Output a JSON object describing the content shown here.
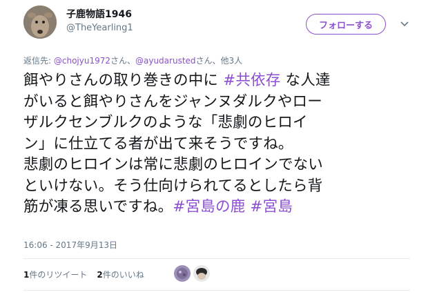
{
  "user": {
    "display_name": "子鹿物語1946",
    "handle": "@TheYearling1"
  },
  "follow_label": "フォローする",
  "reply": {
    "prefix": "返信先: ",
    "mention1": "@chojyu1972",
    "sep1": "さん、",
    "mention2": "@ayudarusted",
    "suffix": "さん、他3人"
  },
  "tweet": {
    "l1a": "餌やりさんの取り巻きの中に ",
    "tag1": "#共依存",
    "l1b": " な人達",
    "l2": "がいると餌やりさんをジャンヌダルクやロー",
    "l3": "ザルクセンブルクのような「悲劇のヒロイ",
    "l4": "ン」に仕立てる者が出て来そうですね。",
    "l5": "悲劇のヒロインは常に悲劇のヒロインでない",
    "l6": "といけない。そう仕向けられてるとしたら背",
    "l7a": "筋が凍る思いですね。",
    "tag2": "#宮島の鹿",
    "tag3": "#宮島"
  },
  "timestamp": "16:06 - 2017年9月13日",
  "stats": {
    "retweet_count": "1",
    "retweet_label": "件のリツイート",
    "like_count": "2",
    "like_label": "件のいいね"
  },
  "colors": {
    "accent": "#8c4fd0",
    "secondary_text": "#657786",
    "divider": "#e6ecf0"
  }
}
